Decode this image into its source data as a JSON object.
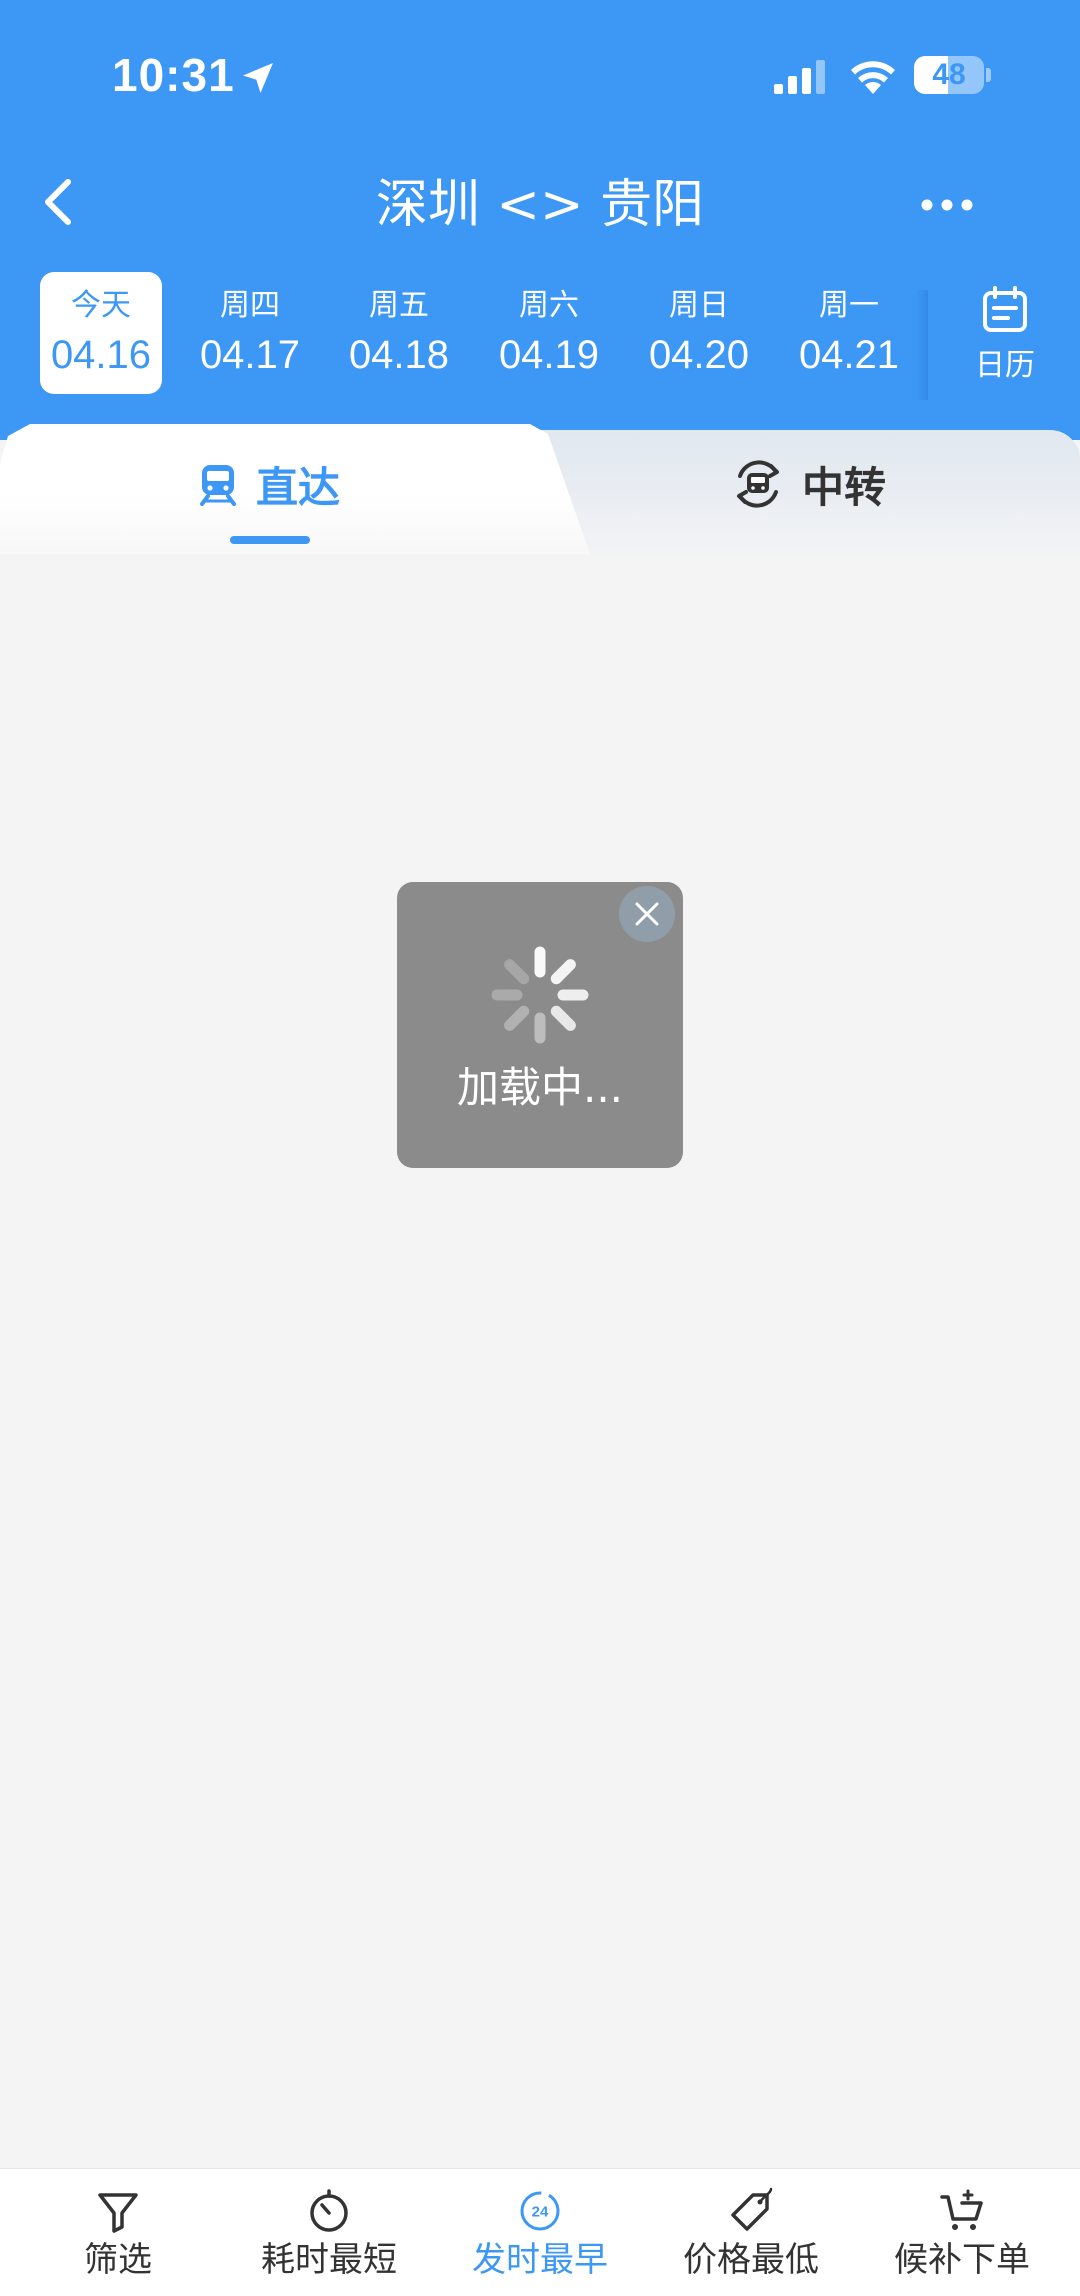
{
  "status_bar": {
    "time": "10:31",
    "battery": "48",
    "battery_level": 0.48
  },
  "nav": {
    "title": "深圳 <> 贵阳",
    "back_icon": "chevron-left-icon",
    "more_icon": "more-dots-icon"
  },
  "dates": [
    {
      "day": "今天",
      "date": "04.16",
      "selected": true
    },
    {
      "day": "周四",
      "date": "04.17",
      "selected": false
    },
    {
      "day": "周五",
      "date": "04.18",
      "selected": false
    },
    {
      "day": "周六",
      "date": "04.19",
      "selected": false
    },
    {
      "day": "周日",
      "date": "04.20",
      "selected": false
    },
    {
      "day": "周一",
      "date": "04.21",
      "selected": false
    }
  ],
  "calendar": {
    "label": "日历"
  },
  "tabs": {
    "direct": {
      "label": "直达",
      "active": true
    },
    "transfer": {
      "label": "中转",
      "active": false
    }
  },
  "loading": {
    "text": "加载中..."
  },
  "bottom_bar": {
    "items": [
      {
        "label": "筛选",
        "icon": "filter-icon",
        "active": false
      },
      {
        "label": "耗时最短",
        "icon": "timer-icon",
        "active": false
      },
      {
        "label": "发时最早",
        "icon": "clock-24-icon",
        "icon_text": "24",
        "active": true
      },
      {
        "label": "价格最低",
        "icon": "price-tag-icon",
        "active": false
      },
      {
        "label": "候补下单",
        "icon": "cart-add-icon",
        "active": false
      }
    ]
  },
  "colors": {
    "primary": "#3d97f5",
    "background": "#f4f4f5",
    "loading_overlay": "#8b8b8b"
  }
}
